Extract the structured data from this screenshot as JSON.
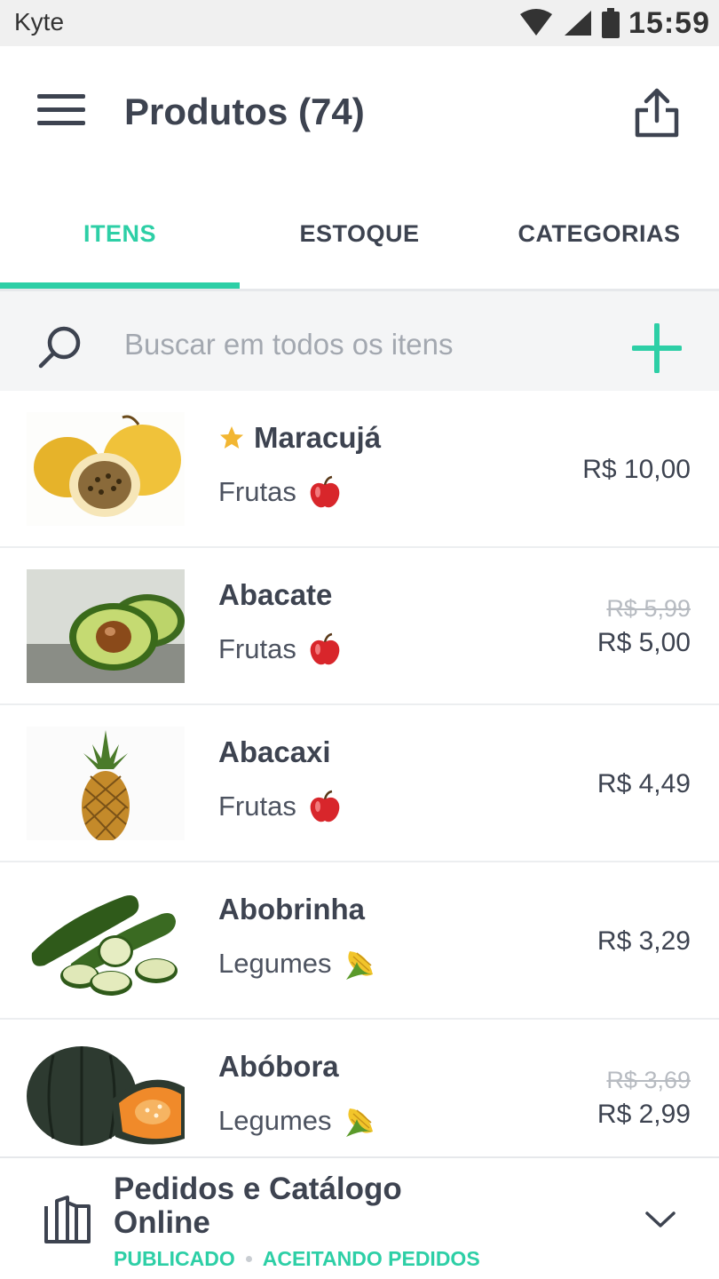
{
  "status_bar": {
    "app_name": "Kyte",
    "time": "15:59",
    "icons": [
      "wifi-icon",
      "signal-icon",
      "battery-icon"
    ]
  },
  "header": {
    "title": "Produtos (74)",
    "menu_icon": "hamburger-menu-icon",
    "share_icon": "share-upload-icon"
  },
  "tabs": [
    {
      "label": "ITENS",
      "active": true
    },
    {
      "label": "ESTOQUE",
      "active": false
    },
    {
      "label": "CATEGORIAS",
      "active": false
    }
  ],
  "search": {
    "placeholder": "Buscar em todos os itens",
    "value": "",
    "add_icon": "plus-icon"
  },
  "products": [
    {
      "name": "Maracujá",
      "favorite": true,
      "category": "Frutas",
      "category_icon": "apple-emoji",
      "old_price": "",
      "price": "R$ 10,00",
      "image": "passion-fruit"
    },
    {
      "name": "Abacate",
      "favorite": false,
      "category": "Frutas",
      "category_icon": "apple-emoji",
      "old_price": "R$ 5,99",
      "price": "R$ 5,00",
      "image": "avocado"
    },
    {
      "name": "Abacaxi",
      "favorite": false,
      "category": "Frutas",
      "category_icon": "apple-emoji",
      "old_price": "",
      "price": "R$ 4,49",
      "image": "pineapple"
    },
    {
      "name": "Abobrinha",
      "favorite": false,
      "category": "Legumes",
      "category_icon": "corn-emoji",
      "old_price": "",
      "price": "R$ 3,29",
      "image": "zucchini"
    },
    {
      "name": "Abóbora",
      "favorite": false,
      "category": "Legumes",
      "category_icon": "corn-emoji",
      "old_price": "R$ 3,69",
      "price": "R$ 2,99",
      "image": "pumpkin"
    }
  ],
  "online_panel": {
    "title": "Pedidos e Catálogo Online",
    "status_published": "PUBLICADO",
    "status_orders": "ACEITANDO PEDIDOS",
    "icon": "book-icon",
    "chevron": "chevron-down-icon"
  },
  "colors": {
    "accent": "#2dcfa6",
    "text": "#3d4350",
    "muted": "#a3a8b0",
    "star": "#f2b632"
  }
}
